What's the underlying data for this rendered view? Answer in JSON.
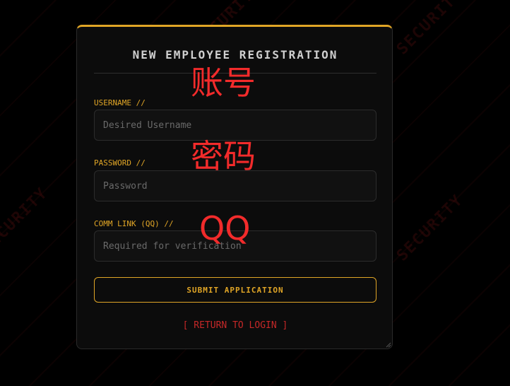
{
  "form": {
    "title": "NEW EMPLOYEE REGISTRATION",
    "username": {
      "label": "USERNAME //",
      "placeholder": "Desired Username",
      "value": ""
    },
    "password": {
      "label": "PASSWORD //",
      "placeholder": "Password",
      "value": ""
    },
    "qq": {
      "label": "COMM LINK (QQ) //",
      "placeholder": "Required for verification",
      "value": ""
    },
    "submit_label": "SUBMIT APPLICATION",
    "return_label": "[ RETURN TO LOGIN ]"
  },
  "overlay_annotations": {
    "username": "账号",
    "password": "密码",
    "qq": "QQ"
  },
  "colors": {
    "accent": "#e0a526",
    "danger": "#c62828",
    "annotation": "#f22b2b",
    "panel": "#0c0c0c",
    "background": "#000000"
  }
}
